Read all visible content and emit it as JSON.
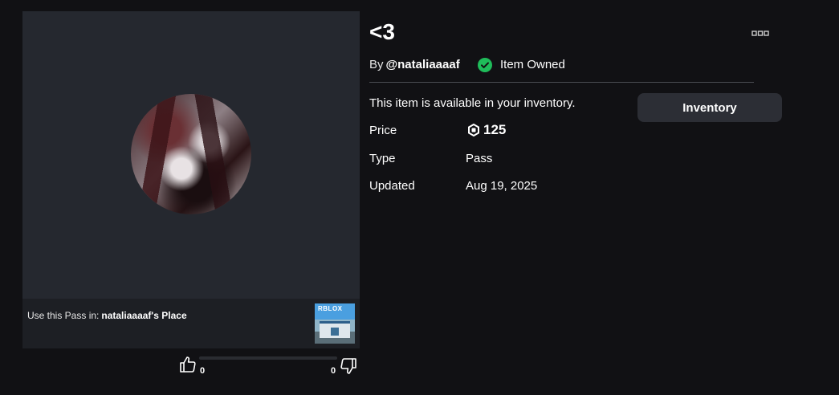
{
  "item": {
    "title": "<3",
    "by_prefix": "By",
    "creator": "@nataliaaaaf",
    "owned_label": "Item Owned",
    "availability": "This item is available in your inventory.",
    "action_button": "Inventory",
    "details": {
      "price_label": "Price",
      "price_value": "125",
      "type_label": "Type",
      "type_value": "Pass",
      "updated_label": "Updated",
      "updated_value": "Aug 19, 2025"
    }
  },
  "usage": {
    "prefix": "Use this Pass in:",
    "place": "nataliaaaaf's Place",
    "place_logo": "RBLOX"
  },
  "votes": {
    "up": "0",
    "down": "0"
  },
  "icons": {
    "more": "more-options-icon",
    "owned": "checkmark-circle-icon",
    "currency": "robux-icon",
    "thumbs_up": "thumbs-up-icon",
    "thumbs_down": "thumbs-down-icon"
  },
  "colors": {
    "background": "#111114",
    "panel": "#25282f",
    "owned_green": "#1fbc5a",
    "button": "#2c2e35"
  }
}
